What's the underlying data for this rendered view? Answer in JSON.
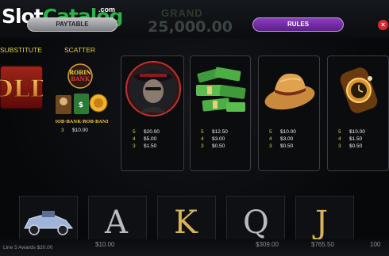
{
  "watermark": {
    "slot": "Slot",
    "catalog": "Catalog",
    "com": ".com"
  },
  "background": {
    "grand_label": "GRAND",
    "grand_value": "25,000.00"
  },
  "tabs": {
    "paytable": "PAYTABLE",
    "rules": "RULES"
  },
  "close_icon": "×",
  "headers": {
    "substitute": "SUBSTITUTE",
    "scatter": "SCATTER"
  },
  "scatter": {
    "logo_text": "Robin Bank",
    "pay": [
      {
        "count": "3",
        "value": "$10.00"
      }
    ]
  },
  "symbols": [
    {
      "name": "gangster",
      "pays": [
        {
          "count": "5",
          "value": "$20.00"
        },
        {
          "count": "4",
          "value": "$5.00"
        },
        {
          "count": "3",
          "value": "$1.50"
        }
      ]
    },
    {
      "name": "money",
      "pays": [
        {
          "count": "5",
          "value": "$12.50"
        },
        {
          "count": "4",
          "value": "$3.00"
        },
        {
          "count": "3",
          "value": "$0.50"
        }
      ]
    },
    {
      "name": "hat",
      "pays": [
        {
          "count": "5",
          "value": "$10.00"
        },
        {
          "count": "4",
          "value": "$3.00"
        },
        {
          "count": "3",
          "value": "$0.50"
        }
      ]
    },
    {
      "name": "watch",
      "pays": [
        {
          "count": "5",
          "value": "$10.00"
        },
        {
          "count": "4",
          "value": "$1.50"
        },
        {
          "count": "3",
          "value": "$0.50"
        }
      ]
    }
  ],
  "reel_letters": [
    "A",
    "K",
    "Q",
    "J"
  ],
  "bottom": {
    "line_award": "Line 5 Awards $20.00",
    "total_win": "$10.00",
    "bet": "$309.00",
    "balance": "$765.50",
    "lines": "100"
  }
}
